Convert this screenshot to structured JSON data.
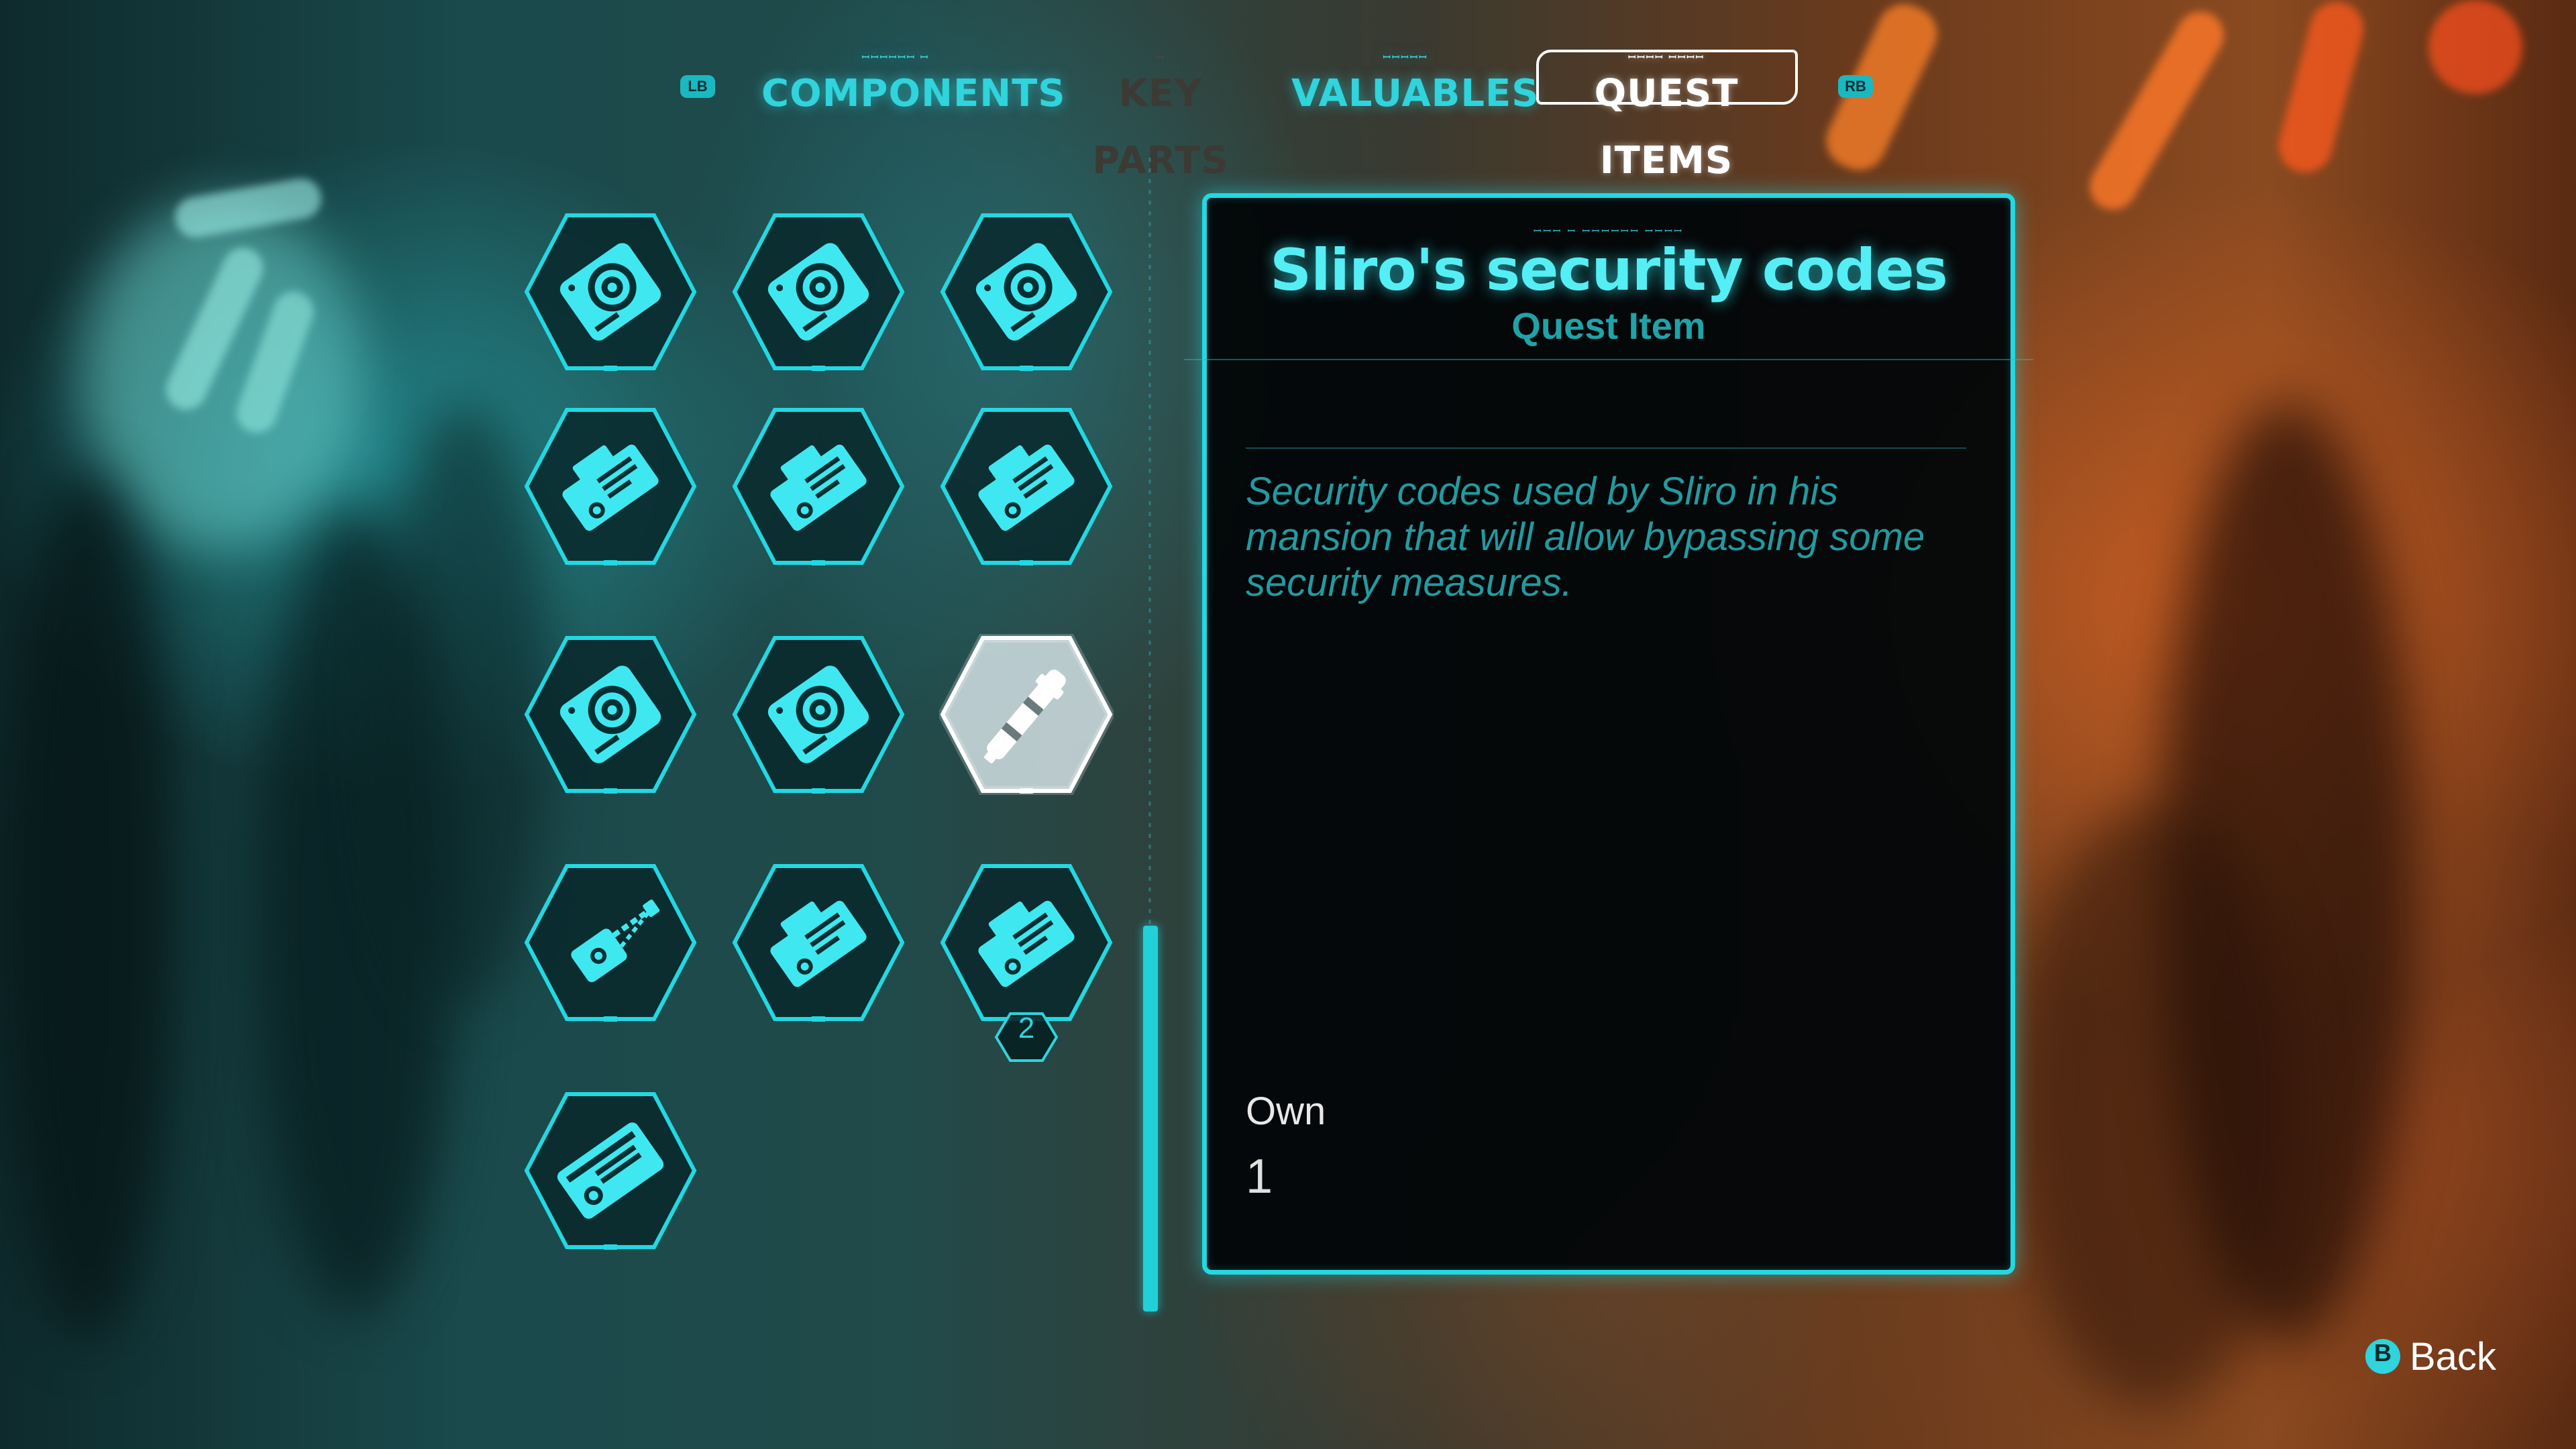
{
  "tabs": {
    "left_bumper": "LB",
    "right_bumper": "RB",
    "items": [
      {
        "label": "COMPONENTS",
        "glyphs": "ꟷꟷꟷꟷꟷꟷ ꟷ"
      },
      {
        "label": "KEY PARTS",
        "glyphs": "ꟷ"
      },
      {
        "label": "VALUABLES",
        "glyphs": "ꟷꟷꟷꟷꟷ"
      },
      {
        "label": "QUEST ITEMS",
        "glyphs": "ꟷꟷꟷꟷ ꟷꟷꟷꟷ"
      }
    ],
    "active_index": 3
  },
  "inventory": {
    "slots": [
      {
        "icon": "data-disc-icon"
      },
      {
        "icon": "data-disc-icon"
      },
      {
        "icon": "data-disc-icon"
      },
      {
        "icon": "keycard-icon"
      },
      {
        "icon": "keycard-icon"
      },
      {
        "icon": "keycard-icon"
      },
      {
        "icon": "data-disc-icon"
      },
      {
        "icon": "data-disc-icon"
      },
      {
        "icon": "code-cylinder-icon",
        "selected": true
      },
      {
        "icon": "datapad-probe-icon"
      },
      {
        "icon": "keycard-icon"
      },
      {
        "icon": "keycard-icon",
        "count": "2"
      },
      {
        "icon": "access-card-icon"
      }
    ]
  },
  "detail": {
    "glyphs": "ꟷꟷꟷ ꟷ ꟷꟷꟷꟷꟷꟷ ꟷꟷꟷꟷ",
    "title": "Sliro's security codes",
    "subtitle": "Quest Item",
    "description": "Security codes used by Sliro in his mansion that will allow bypassing some security measures.",
    "own_label": "Own",
    "own_value": "1"
  },
  "footer": {
    "back_button": "B",
    "back_label": "Back"
  },
  "colors": {
    "accent": "#22d8e2",
    "title": "#55eef5",
    "subtitle": "#1fa3a8",
    "selected": "#ffffff"
  }
}
